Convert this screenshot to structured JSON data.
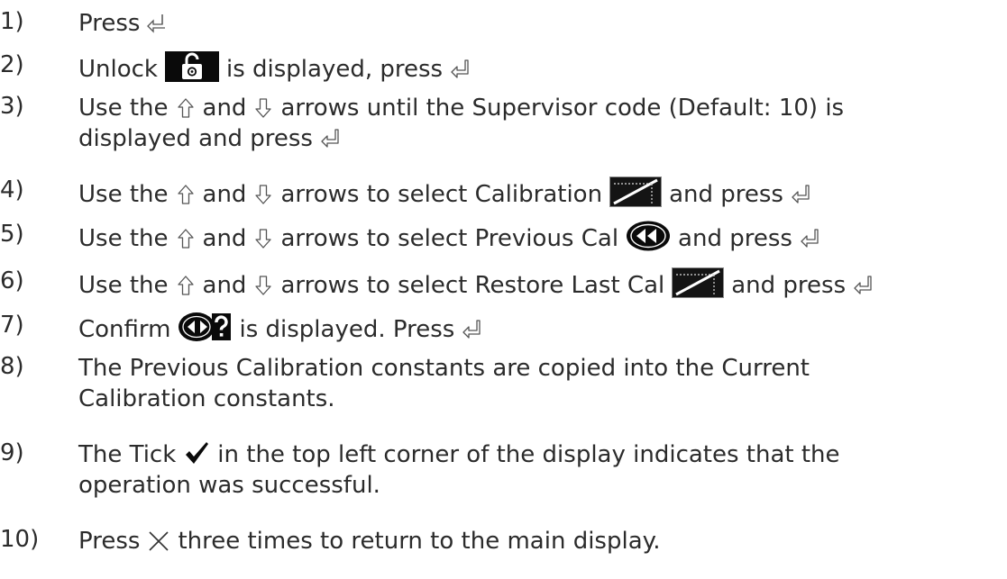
{
  "steps": [
    {
      "num": "1)",
      "segments": [
        "Press"
      ]
    },
    {
      "num": "2)",
      "segments": [
        "Unlock",
        "is displayed, press"
      ]
    },
    {
      "num": "3)",
      "segments": [
        "Use the",
        "and",
        "arrows until the Supervisor code (Default: 10) is",
        "displayed and press"
      ]
    },
    {
      "num": "4)",
      "segments": [
        "Use the",
        "and",
        "arrows to select Calibration",
        "and press"
      ]
    },
    {
      "num": "5)",
      "segments": [
        "Use the",
        "and",
        "arrows to select Previous Cal",
        "and press"
      ]
    },
    {
      "num": "6)",
      "segments": [
        "Use the",
        "and",
        "arrows to select Restore Last Cal",
        "and press"
      ]
    },
    {
      "num": "7)",
      "segments": [
        "Confirm",
        "is displayed. Press"
      ]
    },
    {
      "num": "8)",
      "segments": [
        "The Previous Calibration constants are copied into the Current",
        "Calibration constants."
      ]
    },
    {
      "num": "9)",
      "segments": [
        "The Tick",
        "in the top left corner of the display indicates that the",
        "operation was successful."
      ]
    },
    {
      "num": "10)",
      "segments": [
        "Press",
        "three times to return to the main display."
      ]
    }
  ],
  "icons": {
    "enter": "enter-key-icon",
    "up": "up-arrow-icon",
    "down": "down-arrow-icon",
    "unlock": "unlock-icon",
    "calibration": "calibration-icon",
    "previous_cal": "previous-cal-icon",
    "confirm": "confirm-icon",
    "tick": "tick-icon",
    "cross": "cross-icon"
  }
}
